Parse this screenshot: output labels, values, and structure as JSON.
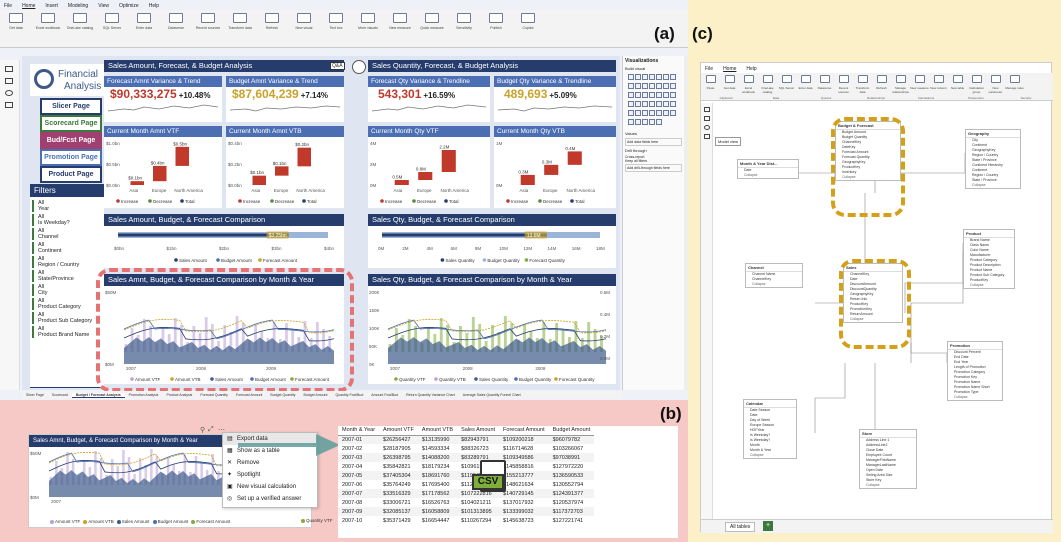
{
  "tags": {
    "a": "(a)",
    "b": "(b)",
    "c": "(c)"
  },
  "menu_a": [
    "File",
    "Home",
    "Insert",
    "Modeling",
    "View",
    "Optimize",
    "Help"
  ],
  "ribbon_a": [
    "Get data",
    "Excel workbook",
    "OneLake catalog",
    "SQL Server",
    "Enter data",
    "Dataverse",
    "Recent sources",
    "Transform data",
    "Refresh",
    "New visual",
    "Text box",
    "More visuals",
    "New measure",
    "Quick measure",
    "Sensitivity",
    "Publish",
    "Copilot"
  ],
  "logo": {
    "line1": "Financial",
    "line2": "Analysis"
  },
  "page_buttons": [
    {
      "label": "Slicer Page",
      "color": "#253c6c"
    },
    {
      "label": "Scorecard Page",
      "color": "#3b7a3b"
    },
    {
      "label": "Bud/Fcst Page",
      "color": "#a04070"
    },
    {
      "label": "Promotion Page",
      "color": "#4c6fb4"
    },
    {
      "label": "Product Page",
      "color": "#253c6c"
    }
  ],
  "filters": {
    "title": "Filters",
    "items": [
      {
        "value": "All",
        "label": "Year"
      },
      {
        "value": "All",
        "label": "Is Weekday?"
      },
      {
        "value": "All",
        "label": "Channel"
      },
      {
        "value": "All",
        "label": "Continent"
      },
      {
        "value": "All",
        "label": "Region / Country"
      },
      {
        "value": "All",
        "label": "State/Province"
      },
      {
        "value": "All",
        "label": "City"
      },
      {
        "value": "All",
        "label": "Product Category"
      },
      {
        "value": "All",
        "label": "Product Sub Category"
      },
      {
        "value": "All",
        "label": "Product Brand Name"
      }
    ]
  },
  "left_section": {
    "header": "Sales Amount, Forecast, & Budget Analysis",
    "qna": "Q&A",
    "kpi1": {
      "title": "Forecast Amnt Variance & Trend",
      "value": "$90,333,275",
      "pct": "+10.48%"
    },
    "kpi2": {
      "title": "Budget Amnt Variance & Trend",
      "value": "$87,604,239",
      "pct": "+7.14%"
    },
    "vtf": {
      "title": "Current Month Amnt VTF",
      "y": [
        "$1.0bn",
        "$0.5bn",
        "$0.0bn"
      ],
      "x": [
        "Asia",
        "Europe",
        "North America",
        "Total"
      ],
      "labels": [
        "$0.1bn",
        "$0.4bn",
        "$0.5bn"
      ]
    },
    "vtb": {
      "title": "Current Month Amnt VTB",
      "y": [
        "$0.4bn",
        "$0.2bn",
        "$0.0bn"
      ],
      "x": [
        "Asia",
        "Europe",
        "North America",
        "Total"
      ],
      "labels": [
        "$0.1bn",
        "$0.1bn",
        "$0.2bn",
        "$0.4bn"
      ]
    },
    "legend": [
      "Increase",
      "Decrease",
      "Total"
    ],
    "comparison": {
      "title": "Sales Amount, Budget, & Forecast Comparison",
      "bar_label": "$3.25bn",
      "ticks": [
        "$0bn",
        "$1bn",
        "$2bn",
        "$3bn",
        "$4bn"
      ],
      "legend": [
        "Sales Amount",
        "Budget Amount",
        "Forecast Amount"
      ]
    },
    "month": {
      "title": "Sales Amnt, Budget, & Forecast Comparison by Month & Year",
      "y": [
        "$50M",
        "$0M"
      ],
      "x": [
        "2007",
        "2008",
        "2009"
      ],
      "legend": [
        "Amount VTF",
        "Amount VTB",
        "Sales Amount",
        "Budget Amount",
        "Forecast Amount"
      ]
    }
  },
  "right_section": {
    "header": "Sales Quantity, Forecast, & Budget Analysis",
    "kpi1": {
      "title": "Forecast Qty Variance & Trendline",
      "value": "543,301",
      "pct": "+16.59%"
    },
    "kpi2": {
      "title": "Budget Qty Variance & Trendline",
      "value": "489,693",
      "pct": "+5.09%"
    },
    "vtf": {
      "title": "Current Month Qty VTF",
      "y": [
        "4M",
        "2M",
        "0M"
      ],
      "x": [
        "Asia",
        "Europe",
        "North America",
        "Total"
      ],
      "labels": [
        "0.5M",
        "0.8M",
        "2.2M",
        "3.6M"
      ]
    },
    "vtb": {
      "title": "Current Month Qty VTB",
      "y": [
        "1M",
        "0M"
      ],
      "x": [
        "Asia",
        "Europe",
        "North America",
        "Total"
      ],
      "labels": [
        "0.3M",
        "0.3M",
        "0.4M",
        "1.1M"
      ]
    },
    "legend": [
      "Increase",
      "Decrease",
      "Total"
    ],
    "comparison": {
      "title": "Sales Qty, Budget, & Forecast Comparison",
      "bar_label": "13.6M",
      "ticks": [
        "0M",
        "2M",
        "4M",
        "6M",
        "8M",
        "10M",
        "12M",
        "14M",
        "16M",
        "18M"
      ],
      "legend": [
        "Sales Quantity",
        "Budget Quantity",
        "Forecast Quantity"
      ]
    },
    "month": {
      "title": "Sales Qty, Budget, & Forecast Comparison by Month & Year",
      "y": [
        "200K",
        "150K",
        "100K",
        "50K",
        "0K"
      ],
      "y2": [
        "0.6M",
        "0.4M",
        "0.2M",
        "0.0M"
      ],
      "x": [
        "2007",
        "2008",
        "2009"
      ],
      "legend": [
        "Quantity VTF",
        "Quantity VTB",
        "Sales Quantity",
        "Budget Quantity",
        "Forecast Quantity"
      ]
    }
  },
  "viz_pane": {
    "title": "Visualizations",
    "build": "Build visual",
    "filters": "Filters",
    "values": "Values",
    "values_hint": "Add data fields here",
    "drill": "Drill through",
    "cross_report": "Cross-report",
    "keep_all": "Keep all filters",
    "drill_hint": "Add drill-through fields here"
  },
  "page_tabs": [
    "Slicer Page",
    "Scorecard",
    "Budget / Forecast Analysis",
    "Promotion Analysis",
    "Product Analysis",
    "Forecast Quantity",
    "Forecast Amount",
    "Budget Quantity",
    "Budget Amount",
    "Quantity Fcst/Bud",
    "Amount Fcst/Bud",
    "Return Quantity Variance Chart",
    "Average Sales Quantity Funnel Chart"
  ],
  "panel_b": {
    "visual_title": "Sales Amnt, Budget, & Forecast Comparison by Month & Year",
    "menu": [
      "Export data",
      "Show as a table",
      "Remove",
      "Spotlight",
      "New visual calculation",
      "Set up a verified answer"
    ],
    "legend": [
      "Amount VTF",
      "Amount VTB",
      "Sales Amount",
      "Budget Amount",
      "Forecast Amount"
    ],
    "legend_right": "Quantity VTF",
    "y": [
      "$50M",
      "$0M"
    ],
    "x": [
      "2007"
    ],
    "csv_label": "CSV",
    "table": {
      "columns": [
        "Month & Year",
        "Amount VTF",
        "Amount VTB",
        "Sales Amount",
        "Forecast Amount",
        "Budget Amount"
      ],
      "rows": [
        [
          "2007-01",
          "$26256427",
          "$13135990",
          "$82943791",
          "$109200218",
          "$96079782"
        ],
        [
          "2007-02",
          "$28187905",
          "$14593334",
          "$88326723",
          "$116714628",
          "$103266067"
        ],
        [
          "2007-03",
          "$26398795",
          "$14088200",
          "$83289791",
          "$109349586",
          "$97038991"
        ],
        [
          "2007-04",
          "$35842821",
          "$18179234",
          "$109615996",
          "$145858816",
          "$127972220"
        ],
        [
          "2007-05",
          "$37405304",
          "$18691760",
          "$119645773",
          "$155213777",
          "$136590533"
        ],
        [
          "2007-06",
          "$35764249",
          "$17695400",
          "$112427385",
          "$148621634",
          "$130552794"
        ],
        [
          "2007-07",
          "$33516329",
          "$17178562",
          "$107222816",
          "$140729145",
          "$124391377"
        ],
        [
          "2007-08",
          "$33006721",
          "$16526763",
          "$104021211",
          "$137017932",
          "$120537974"
        ],
        [
          "2007-09",
          "$32085137",
          "$16058809",
          "$101313895",
          "$133399032",
          "$117372703"
        ],
        [
          "2007-10",
          "$35371429",
          "$16654447",
          "$110267294",
          "$145638723",
          "$127221741"
        ]
      ]
    }
  },
  "panel_c": {
    "menu": [
      "File",
      "Home",
      "Help"
    ],
    "ribbon": [
      "Paste",
      "Get data",
      "Excel workbook",
      "OneLake catalog",
      "SQL Server",
      "Enter data",
      "Dataverse",
      "Recent sources",
      "Transform data",
      "Refresh",
      "Manage relationships",
      "New measure",
      "New column",
      "New table",
      "Calculation group",
      "New parameter",
      "Manage roles"
    ],
    "ribbon_groups": [
      "Clipboard",
      "Data",
      "Queries",
      "Relationships",
      "Calculations",
      "Parameters",
      "Security"
    ],
    "model_view": "Model view",
    "tables": [
      {
        "name": "Budget & Forecast",
        "fields": [
          "Budget Amount",
          "Budget Quantity",
          "ChannelKey",
          "DateKey",
          "Forecast Amount",
          "Forecast Quantity",
          "GeographyKey",
          "ProductKey",
          "Inventory"
        ],
        "collapse": "Collapse"
      },
      {
        "name": "Geography",
        "fields": [
          "City",
          "Continent",
          "GeographyKey",
          "Region / Country",
          "State / Province",
          "Continent Hierarchy",
          "Continent",
          "Region / Country",
          "State / Province"
        ],
        "collapse": "Collapse"
      },
      {
        "name": "Month & Year Dist...",
        "fields": [
          "Date"
        ],
        "collapse": "Collapse"
      },
      {
        "name": "Product",
        "fields": [
          "Brand Name",
          "Class Name",
          "Color Name",
          "Manufacturer",
          "Product Category",
          "Product Description",
          "Product Name",
          "Product Sub Category",
          "ProductKey"
        ],
        "collapse": "Collapse"
      },
      {
        "name": "Channel",
        "fields": [
          "Channel Name",
          "ChannelKey"
        ],
        "collapse": "Collapse"
      },
      {
        "name": "Sales",
        "fields": [
          "ChannelKey",
          "Date",
          "DiscountAmount",
          "DiscountQuantity",
          "GeographyKey",
          "Return Info",
          "ProductKey",
          "PromotionKey",
          "ReturnAmount"
        ],
        "collapse": "Collapse"
      },
      {
        "name": "Promotion",
        "fields": [
          "Discount Percent",
          "End Date",
          "End Year",
          "Length of Promotion",
          "Promotion Category",
          "Promotion Key",
          "Promotion Name",
          "Promotion Name Short",
          "Promotion Type"
        ],
        "collapse": "Collapse"
      },
      {
        "name": "Calendar",
        "fields": [
          "Date Season",
          "Date",
          "Day of Week",
          "Europe Season",
          "HOFYear",
          "Is Weekday?",
          "Is Weekday?",
          "Month",
          "Month & Year"
        ],
        "collapse": "Collapse"
      },
      {
        "name": "Store",
        "fields": [
          "Address Line 1",
          "AddressLine2",
          "Close Date",
          "Employee Count",
          "ManagerFirstName",
          "ManagerLastName",
          "Open Date",
          "Selling Area Size",
          "Store Key"
        ],
        "collapse": "Collapse"
      }
    ],
    "tab": "All tables",
    "add": "+"
  }
}
